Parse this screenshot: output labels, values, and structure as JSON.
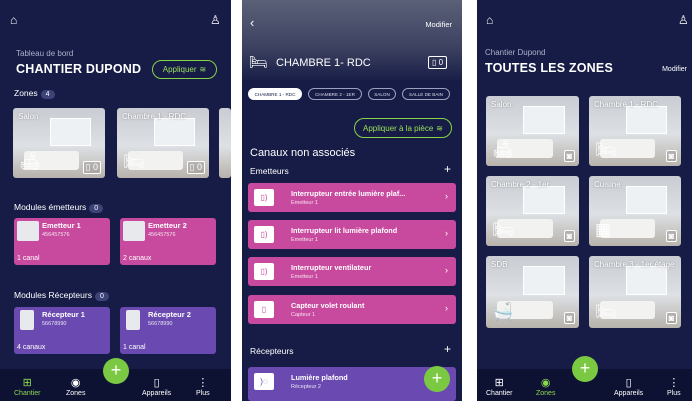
{
  "screen1": {
    "subtitle": "Tableau de bord",
    "title": "CHANTIER DUPOND",
    "apply_btn": "Appliquer",
    "zones_label": "Zones",
    "zones_count": "4",
    "zones": [
      {
        "name": "Salon",
        "count": "0"
      },
      {
        "name": "Chambre 1 - RDC",
        "count": "0"
      }
    ],
    "emitters_label": "Modules émetteurs",
    "emitters_count": "0",
    "emitters": [
      {
        "name": "Emetteur 1",
        "code": "456457576",
        "canals": "1 canal"
      },
      {
        "name": "Emetteur 2",
        "code": "456457576",
        "canals": "2 canaux"
      }
    ],
    "receivers_label": "Modules Récepteurs",
    "receivers_count": "0",
    "receivers": [
      {
        "name": "Récepteur 1",
        "code": "56678990",
        "canals": "4 canaux"
      },
      {
        "name": "Récepteur 2",
        "code": "56678990",
        "canals": "1 canal"
      }
    ],
    "nav": [
      "Chantier",
      "Zones",
      "Appareils",
      "Plus"
    ]
  },
  "screen2": {
    "modify": "Modifier",
    "room_title": "CHAMBRE 1- RDC",
    "room_count": "0",
    "chips": [
      "CHAMBRE 1 - RDC",
      "CHAMBRE 2 - 1ER",
      "SALON",
      "SALLE DE BAIN"
    ],
    "apply_btn": "Appliquer à la pièce",
    "canaux_title": "Canaux non associés",
    "emitters_label": "Emetteurs",
    "emitter_rows": [
      {
        "title": "Interrupteur entrée lumière plaf...",
        "sub": "Emetteur 1"
      },
      {
        "title": "Interrupteur lit lumière plafond",
        "sub": "Emetteur 1"
      },
      {
        "title": "Interrupteur ventilateur",
        "sub": "Emetteur 1"
      },
      {
        "title": "Capteur volet roulant",
        "sub": "Capteur 1"
      }
    ],
    "receivers_label": "Récepteurs",
    "receiver_rows": [
      {
        "title": "Lumière plafond",
        "sub": "Récepteur 2"
      }
    ]
  },
  "screen3": {
    "subtitle": "Chantier Dupond",
    "title": "TOUTES LES ZONES",
    "modify": "Modifier",
    "zones": [
      "Salon",
      "Chambre 1 - RDC",
      "Chambre 2 - 1er",
      "Cuisine",
      "SDB",
      "Chambre 3 - 1er étage"
    ],
    "nav": [
      "Chantier",
      "Zones",
      "Appareils",
      "Plus"
    ]
  },
  "colors": {
    "bg": "#161c45",
    "accent": "#7bc943",
    "emitter": "#c84a9e",
    "receiver": "#6a4ab0"
  }
}
